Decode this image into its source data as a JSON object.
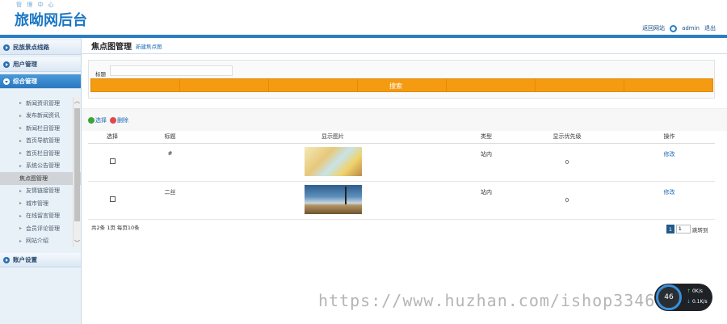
{
  "header": {
    "subtitle": "管 理 中 心",
    "title": "旅呦网后台",
    "links": [
      "返回网站",
      "admin",
      "退出"
    ]
  },
  "sidebar": {
    "sections": [
      "民族景点线路",
      "用户管理",
      "综合管理",
      "账户设置"
    ],
    "submenu": [
      "新闻资讯管理",
      "发布新闻资讯",
      "新闻栏目管理",
      "首页导航管理",
      "首页栏目管理",
      "系统公告管理",
      "焦点图管理",
      "友情链接管理",
      "城市管理",
      "在线留言管理",
      "会员评论管理",
      "网站介绍"
    ],
    "current_index": 6,
    "scroll_up": "︿",
    "scroll_down": "﹀"
  },
  "main": {
    "title": "焦点图管理",
    "new_link": "新建焦点图",
    "search_label": "标题",
    "search_placeholder": "",
    "search_button": "搜索",
    "ops": {
      "select": "选择",
      "delete": "删除"
    },
    "columns": [
      "选择",
      "标题",
      "显示图片",
      "类型",
      "显示优先级",
      "操作"
    ],
    "rows": [
      {
        "title": "#",
        "type": "站内",
        "priority": "0",
        "action": "修改"
      },
      {
        "title": "二丝",
        "type": "站内",
        "priority": "0",
        "action": "修改"
      }
    ],
    "footer_info": "共2条 1页 每页10条",
    "pager": {
      "current": "1",
      "input": "1",
      "go": "跳转到"
    }
  },
  "watermark": "https://www.huzhan.com/ishop33466",
  "gauge": {
    "value": "46",
    "up": "0K/s",
    "down": "0.1K/s"
  },
  "colors": {
    "accent": "#2b7ec3",
    "search_bar": "#f59b12",
    "link": "#1a6bb8"
  }
}
